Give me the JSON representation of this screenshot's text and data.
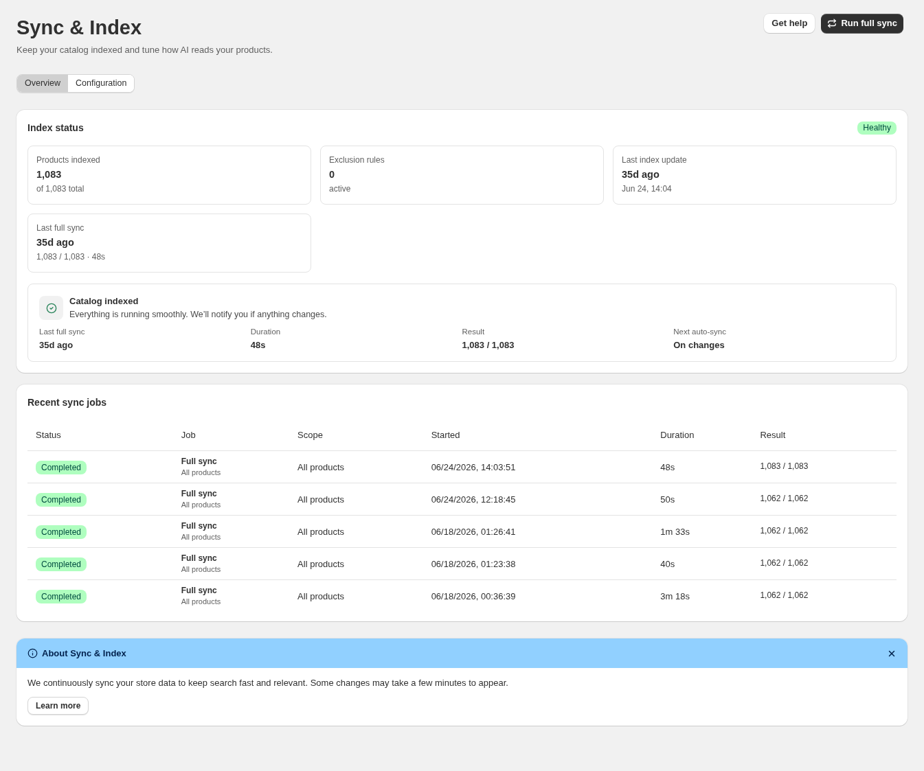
{
  "page": {
    "title": "Sync & Index",
    "subtitle": "Keep your catalog indexed and tune how AI reads your products.",
    "actions": [
      {
        "label": "Get help",
        "kind": "plain"
      },
      {
        "label": "Run full sync",
        "kind": "primary"
      }
    ]
  },
  "tabs": [
    {
      "label": "Overview",
      "selected": true
    },
    {
      "label": "Configuration",
      "selected": false
    }
  ],
  "index_status": {
    "title": "Index status",
    "badge": "Healthy",
    "stats": [
      {
        "label": "Products indexed",
        "value": "1,083",
        "detail": "of 1,083 total"
      },
      {
        "label": "Exclusion rules",
        "value": "0",
        "detail": "active"
      },
      {
        "label": "Last index update",
        "value": "35d ago",
        "detail": "Jun 24, 14:04"
      },
      {
        "label": "Last full sync",
        "value": "35d ago",
        "detail": "1,083 / 1,083 · 48s"
      }
    ],
    "summary": {
      "title": "Catalog indexed",
      "message": "Everything is running smoothly. We’ll notify you if anything changes.",
      "metrics": [
        {
          "label": "Last full sync",
          "value": "35d ago"
        },
        {
          "label": "Duration",
          "value": "48s"
        },
        {
          "label": "Result",
          "value": "1,083 / 1,083"
        },
        {
          "label": "Next auto-sync",
          "value": "On changes"
        }
      ]
    }
  },
  "sync_jobs": {
    "title": "Recent sync jobs",
    "columns": [
      "Status",
      "Job",
      "Scope",
      "Started",
      "Duration",
      "Result"
    ],
    "rows": [
      {
        "status": "Completed",
        "job": "Full sync",
        "job_detail": "All products",
        "scope": "All products",
        "started": "06/24/2026, 14:03:51",
        "duration": "48s",
        "result": "1,083 / 1,083"
      },
      {
        "status": "Completed",
        "job": "Full sync",
        "job_detail": "All products",
        "scope": "All products",
        "started": "06/24/2026, 12:18:45",
        "duration": "50s",
        "result": "1,062 / 1,062"
      },
      {
        "status": "Completed",
        "job": "Full sync",
        "job_detail": "All products",
        "scope": "All products",
        "started": "06/18/2026, 01:26:41",
        "duration": "1m 33s",
        "result": "1,062 / 1,062"
      },
      {
        "status": "Completed",
        "job": "Full sync",
        "job_detail": "All products",
        "scope": "All products",
        "started": "06/18/2026, 01:23:38",
        "duration": "40s",
        "result": "1,062 / 1,062"
      },
      {
        "status": "Completed",
        "job": "Full sync",
        "job_detail": "All products",
        "scope": "All products",
        "started": "06/18/2026, 00:36:39",
        "duration": "3m 18s",
        "result": "1,062 / 1,062"
      }
    ]
  },
  "banner": {
    "title": "About Sync & Index",
    "message": "We continuously sync your store data to keep search fast and relevant. Some changes may take a few minutes to appear.",
    "button": "Learn more"
  }
}
